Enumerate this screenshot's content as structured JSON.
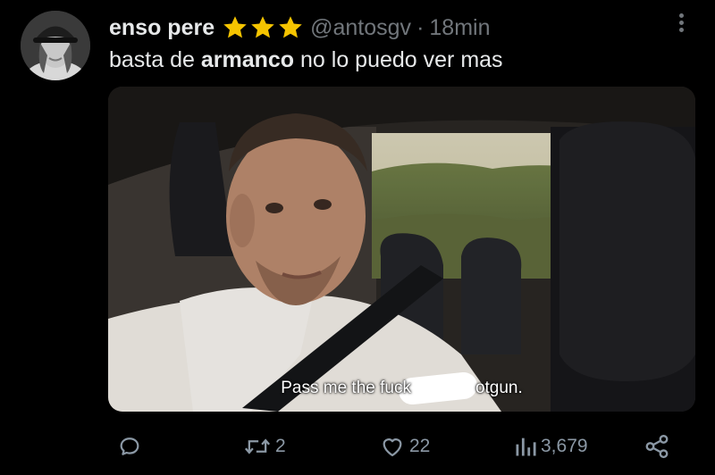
{
  "tweet": {
    "author": {
      "display_name": "enso pere",
      "badge_icon": "three-yellow-stars",
      "handle": "@antosgv",
      "separator": "·",
      "time": "18min"
    },
    "text": {
      "before": "basta de ",
      "bold": "armanco",
      "after": " no lo puedo ver mas"
    },
    "media": {
      "subtitle_left": "Pass me the fuck",
      "subtitle_right": "otgun."
    },
    "actions": {
      "replies_icon": "reply-icon",
      "retweets_icon": "retweet-icon",
      "retweets": "2",
      "likes_icon": "like-icon",
      "likes": "22",
      "views_icon": "views-icon",
      "views": "3,679",
      "share_icon": "share-icon"
    },
    "colors": {
      "background": "#000000",
      "text": "#e7e9ea",
      "muted": "#71767b",
      "icon": "#8b98a5",
      "star": "#f5c400"
    }
  }
}
